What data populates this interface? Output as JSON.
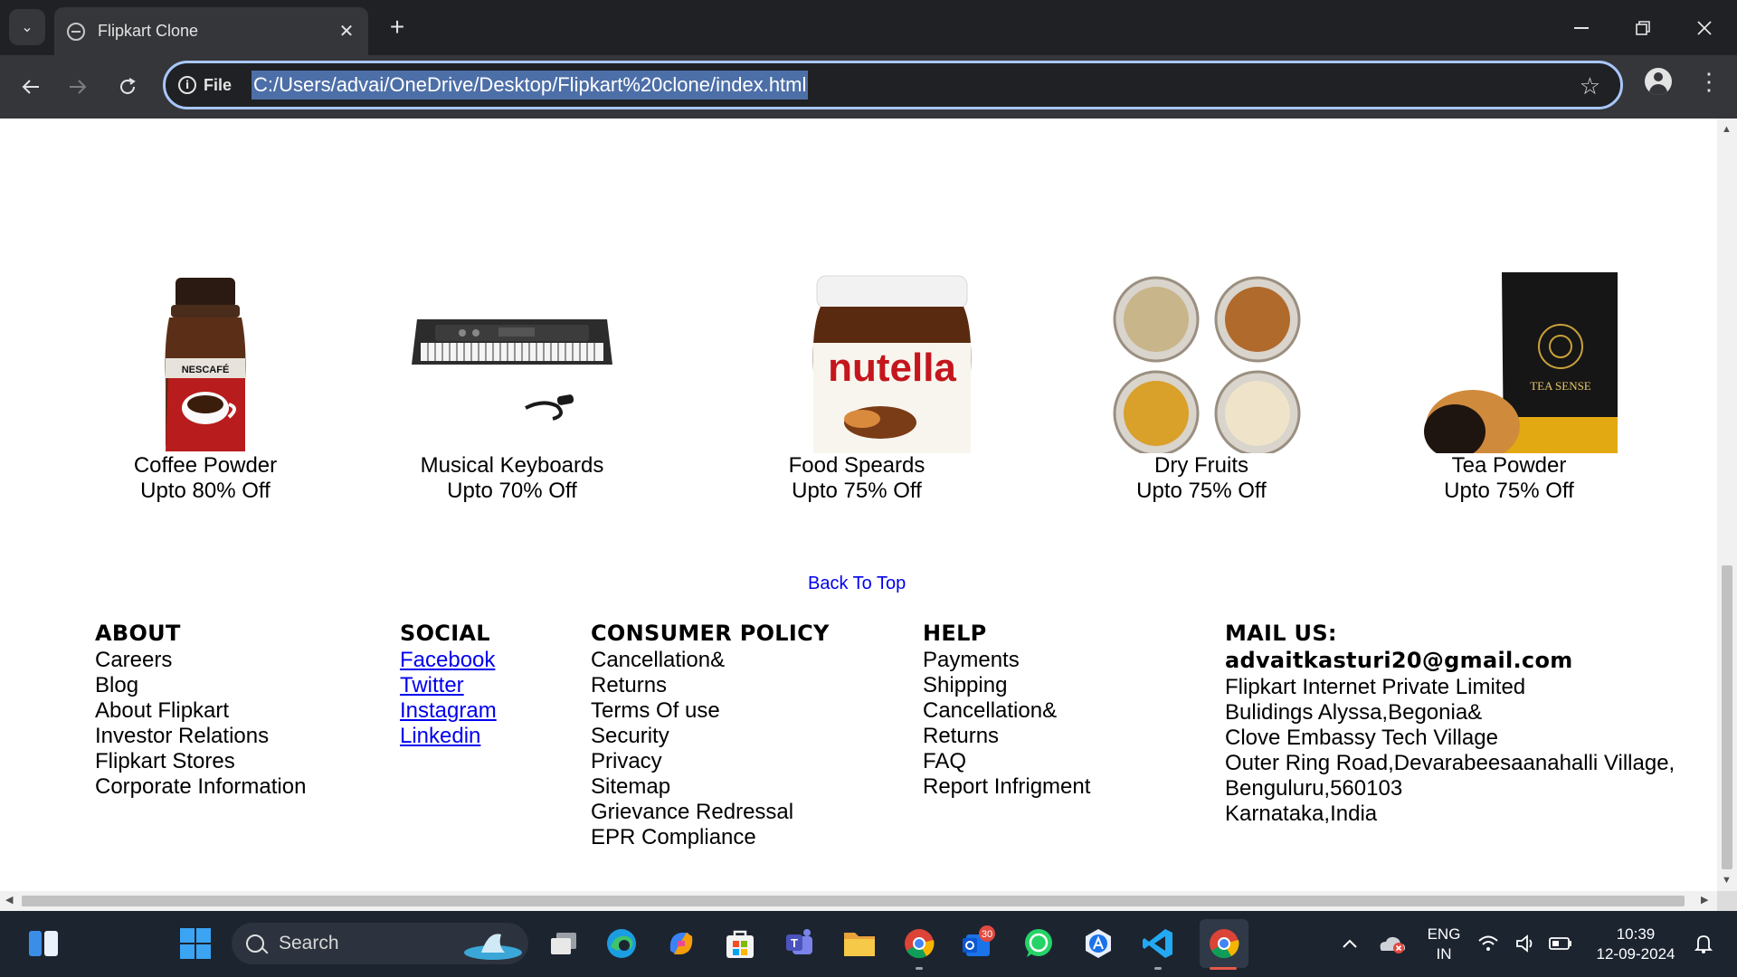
{
  "browser": {
    "tab_title": "Flipkart Clone",
    "site_info_label": "File",
    "url": "C:/Users/advai/OneDrive/Desktop/Flipkart%20clone/index.html"
  },
  "products": [
    {
      "name": "Coffee Powder",
      "offer": "Upto 80% Off",
      "icon": "coffee-jar-icon"
    },
    {
      "name": "Musical Keyboards",
      "offer": "Upto 70% Off",
      "icon": "keyboard-icon"
    },
    {
      "name": "Food Speards",
      "offer": "Upto 75% Off",
      "icon": "spread-jar-icon"
    },
    {
      "name": "Dry Fruits",
      "offer": "Upto 75% Off",
      "icon": "dry-fruits-icon"
    },
    {
      "name": "Tea Powder",
      "offer": "Upto 75% Off",
      "icon": "tea-pack-icon"
    }
  ],
  "product_labels": {
    "coffee_brand": "NESCAFÉ",
    "spread_brand": "nutella",
    "tea_brand": "TEA SENSE"
  },
  "back_to_top": "Back To Top",
  "footer": {
    "about": {
      "heading": "ABOUT",
      "items": [
        "Careers",
        "Blog",
        "About Flipkart",
        "Investor Relations",
        "Flipkart Stores",
        "Corporate Information"
      ]
    },
    "social": {
      "heading": "SOCIAL",
      "links": [
        "Facebook",
        "Twitter",
        "Instagram",
        "Linkedin"
      ]
    },
    "consumer_policy": {
      "heading": "CONSUMER POLICY",
      "items": [
        "Cancellation&",
        "Returns",
        "Terms Of use",
        "Security",
        "Privacy",
        "Sitemap",
        "Grievance Redressal",
        "EPR Compliance"
      ]
    },
    "help": {
      "heading": "HELP",
      "items": [
        "Payments",
        "Shipping",
        "Cancellation&",
        "Returns",
        "FAQ",
        "Report Infrigment"
      ]
    },
    "mail": {
      "heading": "MAIL US:",
      "email": "advaitkasturi20@gmail.com",
      "address": [
        "Flipkart Internet Private Limited",
        "Bulidings Alyssa,Begonia&",
        "Clove Embassy Tech Village",
        "Outer Ring Road,Devarabeesaanahalli Village,",
        "Benguluru,560103",
        "Karnataka,India"
      ]
    }
  },
  "taskbar": {
    "search_placeholder": "Search",
    "badge_count": "30",
    "language_line1": "ENG",
    "language_line2": "IN",
    "time": "10:39",
    "date": "12-09-2024"
  },
  "colors": {
    "link": "#0000ee",
    "chrome_dark": "#1f2124",
    "toolbar": "#35363a",
    "taskbar": "#1c2430",
    "omnibox_focus": "#a8c7fa"
  }
}
